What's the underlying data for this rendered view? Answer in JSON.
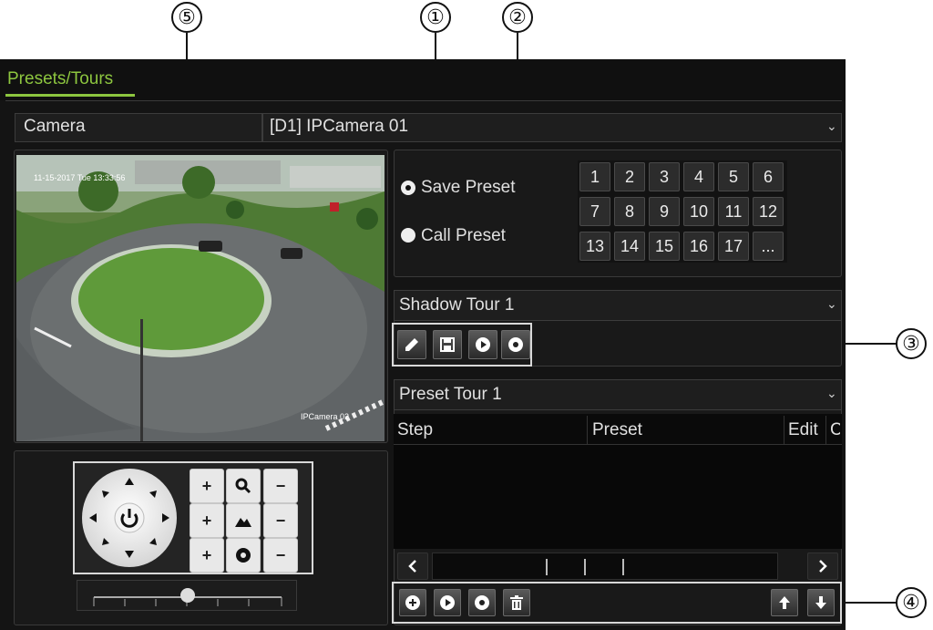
{
  "callouts": [
    "⑤",
    "①",
    "②",
    "③",
    "④"
  ],
  "tab": {
    "label": "Presets/Tours"
  },
  "camera": {
    "label": "Camera",
    "value": "[D1] IPCamera 01"
  },
  "video": {
    "timestamp": "11-15-2017 Tue 13:33:56",
    "camera_name": "IPCamera 02"
  },
  "presets": {
    "save_label": "Save Preset",
    "call_label": "Call Preset",
    "selected": "save",
    "buttons": [
      "1",
      "2",
      "3",
      "4",
      "5",
      "6",
      "7",
      "8",
      "9",
      "10",
      "11",
      "12",
      "13",
      "14",
      "15",
      "16",
      "17",
      "..."
    ]
  },
  "shadow_tour": {
    "value": "Shadow Tour 1"
  },
  "preset_tour": {
    "value": "Preset Tour 1",
    "columns": [
      "Step",
      "Preset",
      "Edit",
      "C"
    ]
  },
  "ptz": {
    "plus": "+",
    "minus": "−"
  },
  "accent_color": "#8dc63f"
}
